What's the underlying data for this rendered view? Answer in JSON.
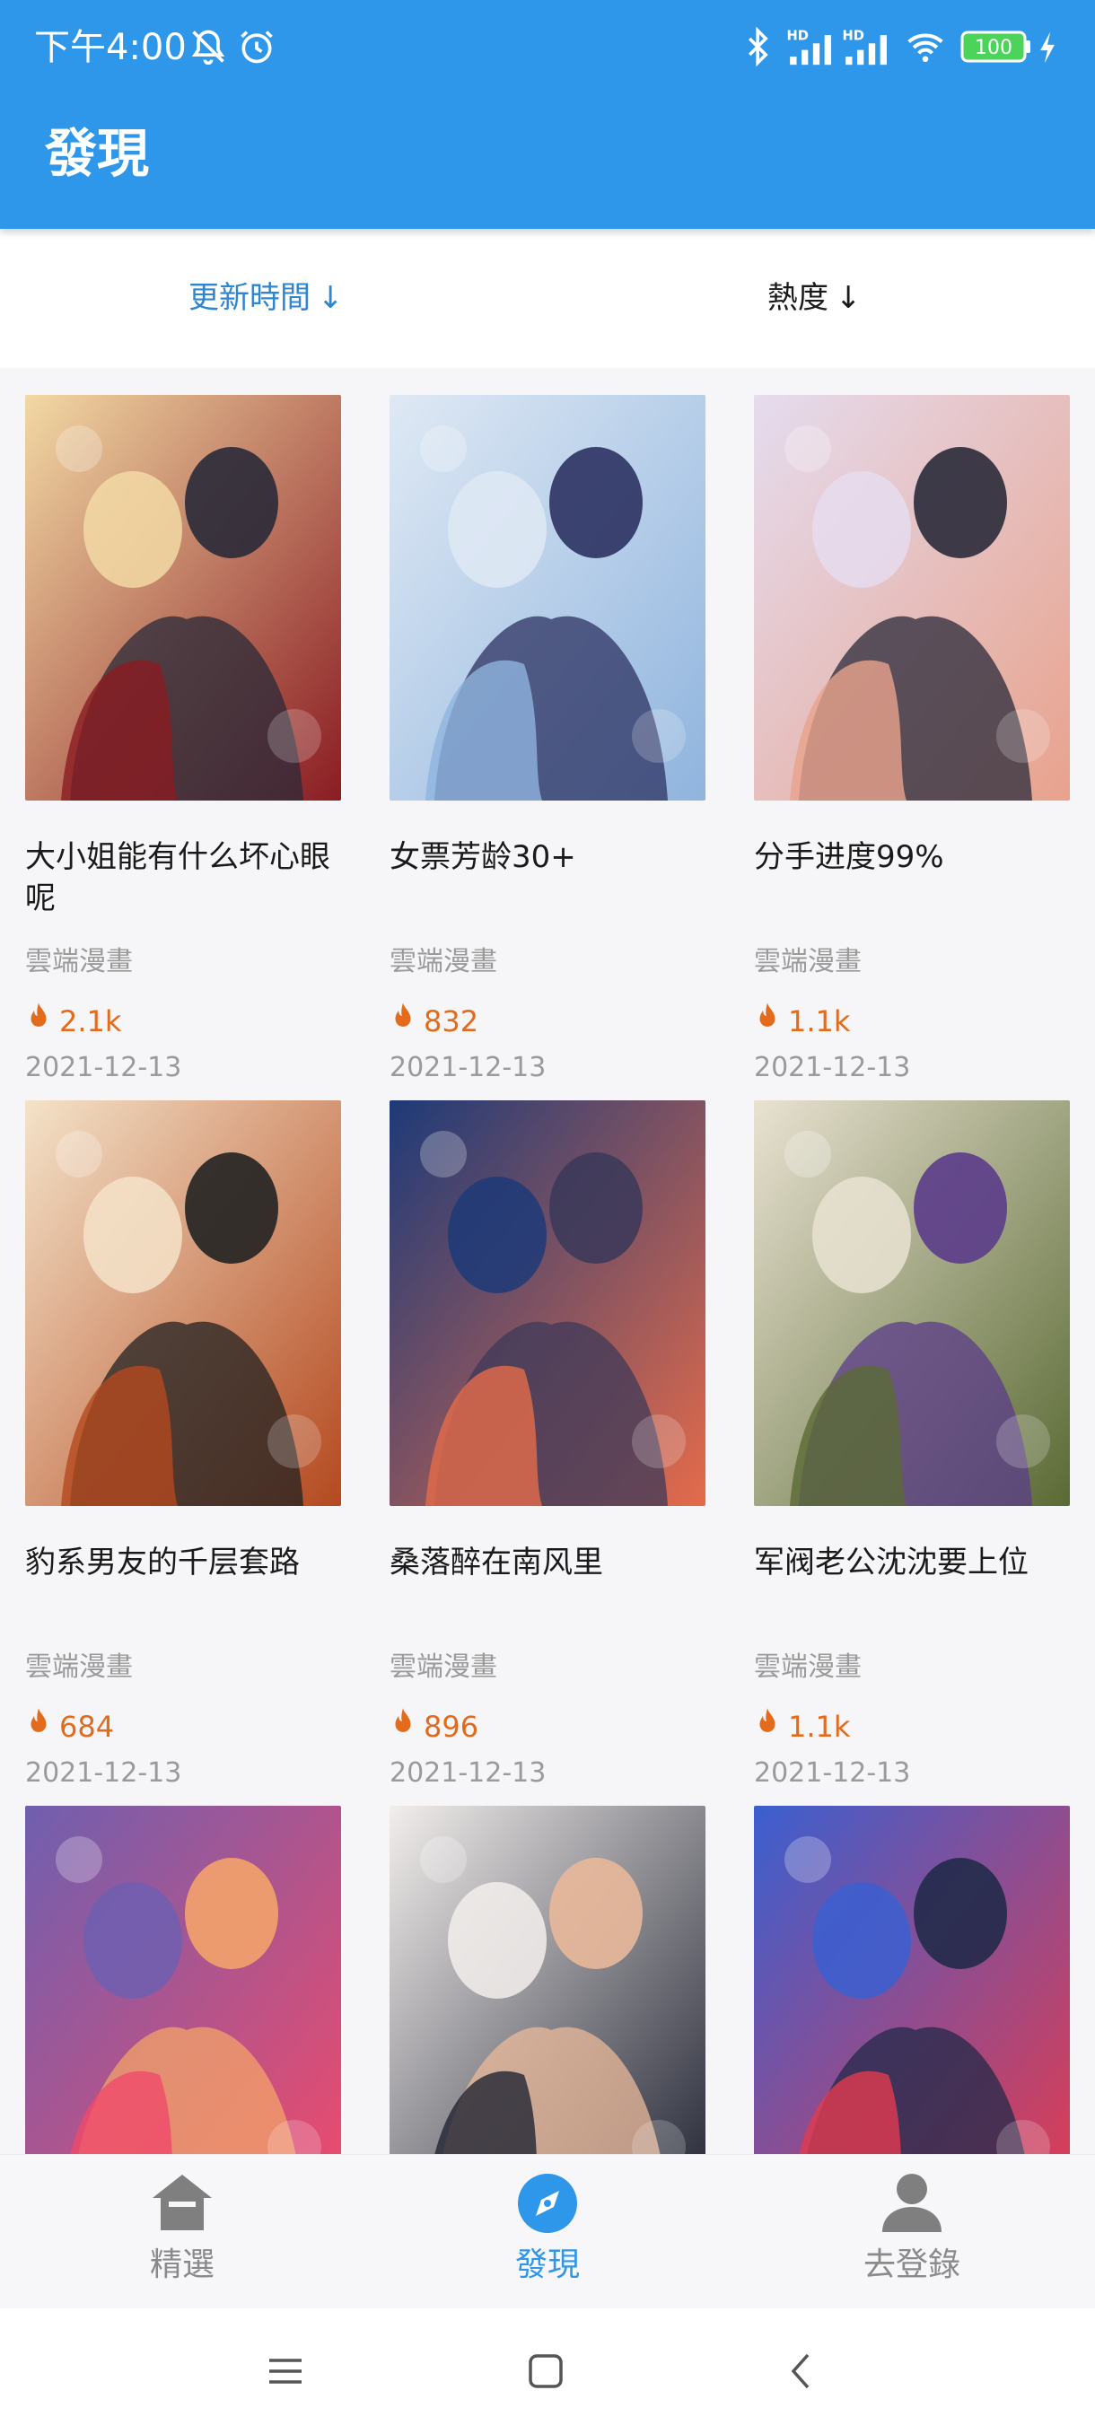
{
  "status_bar": {
    "time": "下午4:00",
    "battery": "100",
    "icons": [
      "mute-bell-icon",
      "alarm-icon",
      "bluetooth-icon",
      "hd-signal-icon",
      "hd-signal-icon",
      "wifi-icon",
      "battery-icon",
      "charging-icon"
    ]
  },
  "header": {
    "title": "發現"
  },
  "sort": {
    "options": [
      {
        "label": "更新時間",
        "active": true
      },
      {
        "label": "熱度",
        "active": false
      }
    ],
    "arrow": "↓"
  },
  "items": [
    {
      "title": "大小姐能有什么坏心眼呢",
      "publisher": "雲端漫畫",
      "heat": "2.1k",
      "date": "2021-12-13",
      "palette": [
        "#f2d9a4",
        "#8a1c22",
        "#2a2a38"
      ]
    },
    {
      "title": "女票芳龄30+",
      "publisher": "雲端漫畫",
      "heat": "832",
      "date": "2021-12-13",
      "palette": [
        "#dfe9f4",
        "#8fb4de",
        "#2c3262"
      ]
    },
    {
      "title": "分手进度99%",
      "publisher": "雲端漫畫",
      "heat": "1.1k",
      "date": "2021-12-13",
      "palette": [
        "#e5dcef",
        "#e8a28c",
        "#2a2a3a"
      ]
    },
    {
      "title": "豹系男友的千层套路",
      "publisher": "雲端漫畫",
      "heat": "684",
      "date": "2021-12-13",
      "palette": [
        "#f4e3c9",
        "#b4491f",
        "#222222"
      ]
    },
    {
      "title": "桑落醉在南风里",
      "publisher": "雲端漫畫",
      "heat": "896",
      "date": "2021-12-13",
      "palette": [
        "#1d3a78",
        "#e56b4a",
        "#3d3a5a"
      ]
    },
    {
      "title": "军阀老公沈沈要上位",
      "publisher": "雲端漫畫",
      "heat": "1.1k",
      "date": "2021-12-13",
      "palette": [
        "#e9e2d2",
        "#5a6a34",
        "#5b3c8a"
      ]
    },
    {
      "title": "",
      "publisher": "",
      "heat": "",
      "date": "",
      "palette": [
        "#6f5fb0",
        "#f04a6a",
        "#f3a36a"
      ]
    },
    {
      "title": "",
      "publisher": "",
      "heat": "",
      "date": "",
      "palette": [
        "#f2eeec",
        "#222533",
        "#e9b89a"
      ]
    },
    {
      "title": "",
      "publisher": "",
      "heat": "",
      "date": "",
      "palette": [
        "#3b5fd0",
        "#e23b4f",
        "#222a4a"
      ]
    }
  ],
  "bottom_nav": [
    {
      "label": "精選",
      "icon": "home-icon",
      "active": false
    },
    {
      "label": "發現",
      "icon": "compass-icon",
      "active": true
    },
    {
      "label": "去登錄",
      "icon": "user-icon",
      "active": false
    }
  ],
  "system_nav": [
    "menu-icon",
    "home-square-icon",
    "back-icon"
  ],
  "colors": {
    "primary": "#2f97ea",
    "heat": "#e46a1c",
    "active_sort": "#2f86d0"
  }
}
